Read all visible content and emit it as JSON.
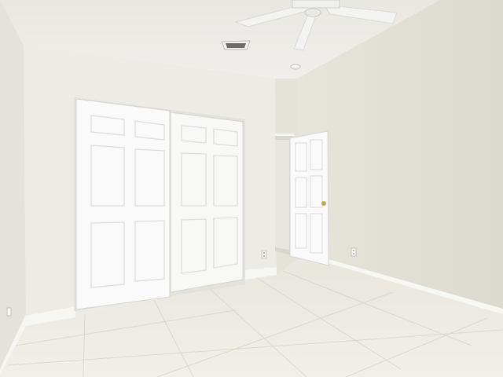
{
  "scene": {
    "description_alt": "",
    "palette": {
      "ceiling": "#ecebe6",
      "wall_left": "#e7e6e0",
      "wall_back": "#ecebe5",
      "wall_right": "#e1dfd6",
      "floor": "#ebe8e0",
      "grout": "#d9d5cb",
      "door": "#fafafa",
      "door_shadow": "#dcdcd8",
      "trim": "#f7f7f5",
      "doorway_dark": "#cfcfc8",
      "knob": "#c8a44a"
    },
    "icons": [
      "ceiling-fan-icon",
      "air-vent-icon",
      "smoke-detector-icon",
      "electrical-outlet-icon",
      "door-knob-icon"
    ]
  }
}
